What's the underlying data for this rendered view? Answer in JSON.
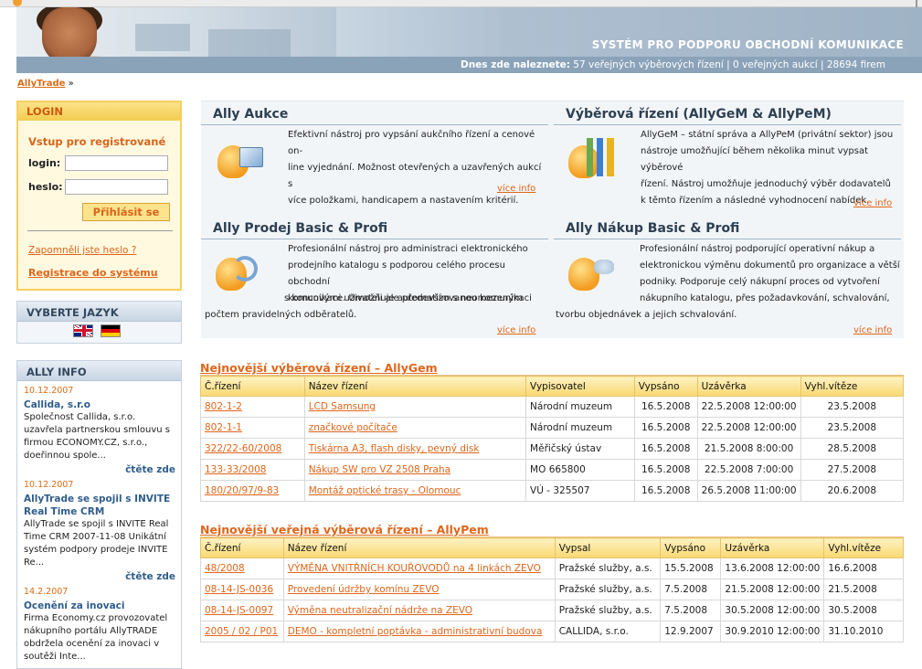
{
  "header": {
    "system_title": "SYSTÉM PRO PODPORU OBCHODNÍ KOMUNIKACE",
    "stats_label": "Dnes zde naleznete:",
    "stats_text": "57 veřejných výběrových řízení | 0 veřejných aukcí | 28694 firem"
  },
  "breadcrumb": {
    "home": "AllyTrade",
    "sep": "»"
  },
  "login": {
    "title": "LOGIN",
    "subtitle": "Vstup pro registrované",
    "login_label": "login:",
    "password_label": "heslo:",
    "login_value": "",
    "password_value": "",
    "submit": "Přihlásit se",
    "forgot": "Zapomněli jste heslo ?",
    "register": "Registrace do systému"
  },
  "language": {
    "title": "VYBERTE JAZYK",
    "flags": [
      "uk-flag",
      "de-flag"
    ]
  },
  "ally_info": {
    "title": "ALLY INFO",
    "items": [
      {
        "date": "10.12.2007",
        "title": "Callida, s.r.o",
        "text": "Společnost Callida, s.r.o. uzavřela partnerskou smlouvu s firmou ECONOMY.CZ, s.r.o., doeřinnou spole...",
        "more": "čtěte zde"
      },
      {
        "date": "10.12.2007",
        "title": "AllyTrade se spojil s INVITE Real Time CRM",
        "text": "AllyTrade se spojil s INVITE Real Time CRM 2007-11-08 Unikátní systém podpory prodeje INVITE Re...",
        "more": "čtěte zde"
      },
      {
        "date": "14.2.2007",
        "title": "Ocenění za inovaci",
        "text": "Firma Economy.cz provozovatel nákupního portálu AllyTRADE obdržela ocenění za inovaci v soutěži Inte...",
        "more": ""
      }
    ]
  },
  "products": [
    {
      "title": "Ally Aukce",
      "icon": "auction-icon",
      "desc": [
        "Efektivní nástroj pro vypsání aukčního řízení a cenové on-",
        "line vyjednání. Možnost otevřených a uzavřených aukcí s",
        "více položkami, handicapem a nastavením kritérií."
      ],
      "more": "více info"
    },
    {
      "title": "Výběrová řízení (AllyGeM & AllyPeM)",
      "icon": "tender-chart-icon",
      "desc": [
        "AllyGeM – státní správa a AllyPeM (privátní sektor) jsou",
        "nástroje umožňující během několika minut vypsat výběrové",
        "řízení. Nástroj umožňuje jednoduchý výběr dodavatelů",
        "k těmto řízením a následné vyhodnocení nabídek."
      ],
      "more": "více info"
    },
    {
      "title": "Ally Prodej Basic & Profi",
      "icon": "sales-icon",
      "desc": [
        "Profesionální nástroj pro administraci elektronického",
        "prodejního katalogu s podporou celého procesu obchodní",
        "komunikace. Umožňuje automatizovanou komunikaci",
        "s koncovými uživateli ale především s neomezeným",
        "počtem pravidelných odběratelů."
      ],
      "more": "více info"
    },
    {
      "title": "Ally Nákup Basic & Profi",
      "icon": "purchase-icon",
      "desc": [
        "Profesionální nástroj podporující operativní nákup a",
        "elektronickou výměnu dokumentů pro organizace a větší",
        "podniky. Podporuje celý nákupní proces od vytvoření",
        "nákupního katalogu, přes požadavkování, schvalování,",
        "tvorbu objednávek a jejich schvalování."
      ],
      "more": "více info"
    }
  ],
  "allygem": {
    "title": "Nejnovější výběrová řízení – AllyGem",
    "headers": [
      "Č.řízení",
      "Název řízení",
      "Vypisovatel",
      "Vypsáno",
      "Uzávěrka",
      "Vyhl.vítěze"
    ],
    "rows": [
      [
        "802-1-2",
        "LCD Samsung",
        "Národní muzeum",
        "16.5.2008",
        "22.5.2008 12:00:00",
        "23.5.2008"
      ],
      [
        "802-1-1",
        "značkové počítače",
        "Národní muzeum",
        "16.5.2008",
        "22.5.2008 12:00:00",
        "23.5.2008"
      ],
      [
        "322/22-60/2008",
        "Tiskárna A3, flash disky, pevný disk",
        "Měřičský ústav",
        "16.5.2008",
        "21.5.2008 8:00:00",
        "28.5.2008"
      ],
      [
        "133-33/2008",
        "Nákup SW pro VZ 2508 Praha",
        "MO 665800",
        "16.5.2008",
        "22.5.2008 7:00:00",
        "27.5.2008"
      ],
      [
        "180/20/97/9-83",
        "Montáž optické trasy - Olomouc",
        "VÚ - 325507",
        "16.5.2008",
        "26.5.2008 11:00:00",
        "20.6.2008"
      ]
    ]
  },
  "allypem": {
    "title": "Nejnovější veřejná výběrová řízení – AllyPem",
    "headers": [
      "Č.řízení",
      "Název řízení",
      "Vypsal",
      "Vypsáno",
      "Uzávěrka",
      "Vyhl.vítěze"
    ],
    "rows": [
      [
        "48/2008",
        "VÝMĚNA VNITŘNÍCH KOUŘOVODŮ na 4 linkách ZEVO",
        "Pražské služby, a.s.",
        "15.5.2008",
        "13.6.2008 12:00:00",
        "16.6.2008"
      ],
      [
        "08-14-JS-0036",
        "Provedení údržby komínu ZEVO",
        "Pražské služby, a.s.",
        "7.5.2008",
        "21.5.2008 12:00:00",
        "21.5.2008"
      ],
      [
        "08-14-JS-0097",
        "Výměna neutralizační nádrže na ZEVO",
        "Pražské služby, a.s.",
        "7.5.2008",
        "30.5.2008 12:00:00",
        "30.5.2008"
      ],
      [
        "2005 / 02 / P01",
        "DEMO - kompletní poptávka - administrativní budova",
        "CALLIDA, s.r.o.",
        "12.9.2007",
        "30.9.2010 12:00:00",
        "31.10.2010"
      ]
    ]
  }
}
